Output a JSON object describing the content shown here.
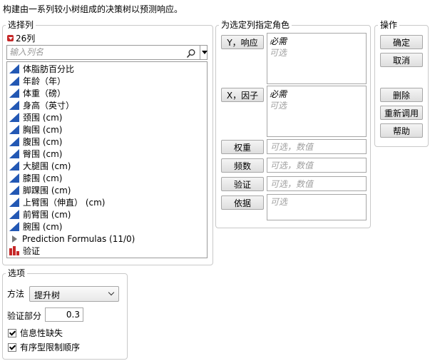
{
  "description": "构建由一系列较小树组成的决策树以预测响应。",
  "select_columns": {
    "title": "选择列",
    "count_label": "26列",
    "search_placeholder": "输入列名",
    "columns": [
      {
        "label": "体脂肪百分比",
        "type": "continuous-icon"
      },
      {
        "label": "年龄（年）",
        "type": "continuous-icon"
      },
      {
        "label": "体重（磅）",
        "type": "continuous-icon"
      },
      {
        "label": "身高（英寸）",
        "type": "continuous-icon"
      },
      {
        "label": "颈围 (cm)",
        "type": "continuous-icon"
      },
      {
        "label": "胸围 (cm)",
        "type": "continuous-icon"
      },
      {
        "label": "腹围 (cm)",
        "type": "continuous-icon"
      },
      {
        "label": "臀围 (cm)",
        "type": "continuous-icon"
      },
      {
        "label": "大腿围 (cm)",
        "type": "continuous-icon"
      },
      {
        "label": "膝围 (cm)",
        "type": "continuous-icon"
      },
      {
        "label": "脚踝围 (cm)",
        "type": "continuous-icon"
      },
      {
        "label": "上臂围（伸直） (cm)",
        "type": "continuous-icon"
      },
      {
        "label": "前臂围 (cm)",
        "type": "continuous-icon"
      },
      {
        "label": "腕围 (cm)",
        "type": "continuous-icon"
      },
      {
        "label": "Prediction Formulas (11/0)",
        "type": "group-expand-icon"
      },
      {
        "label": "验证",
        "type": "nominal-bar-icon"
      }
    ]
  },
  "roles": {
    "title": "为选定列指定角色",
    "y_button": "Y，响应",
    "x_button": "X，因子",
    "weight_button": "权重",
    "freq_button": "频数",
    "validation_button": "验证",
    "by_button": "依据",
    "required_text": "必需",
    "optional_text": "可选",
    "optional_numeric_text": "可选，数值"
  },
  "actions": {
    "title": "操作",
    "ok": "确定",
    "cancel": "取消",
    "remove": "删除",
    "recall": "重新调用",
    "help": "帮助"
  },
  "options": {
    "title": "选项",
    "method_label": "方法",
    "method_value": "提升树",
    "validation_portion_label": "验证部分",
    "validation_portion_value": "0.3",
    "informative_missing_label": "信息性缺失",
    "informative_missing_checked": true,
    "ordinal_restrict_label": "有序型限制顺序",
    "ordinal_restrict_checked": true
  },
  "colors": {
    "continuous_icon": "#2358b4",
    "nominal_icon": "#c62828",
    "red_toggle": "#c62828"
  }
}
